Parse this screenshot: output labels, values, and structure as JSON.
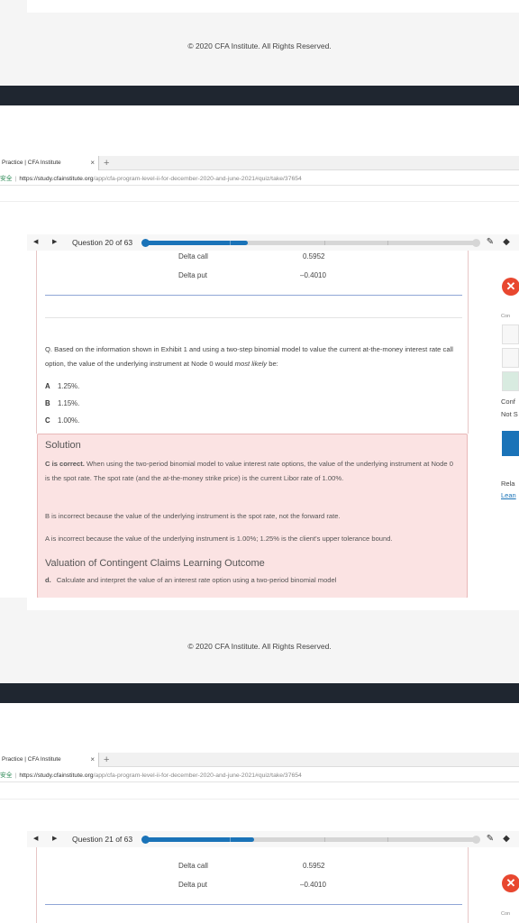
{
  "copyright": "© 2020 CFA Institute. All Rights Reserved.",
  "browser": {
    "tab_title": "Practice | CFA Institute",
    "tab_close": "×",
    "new_tab": "+",
    "secure_label": "安全",
    "url_host": "https://study.cfainstitute.org",
    "url_path": "/app/cfa-program-level-ii-for-december-2020-and-june-2021#quiz/take/37654"
  },
  "quiz1": {
    "question_label": "Question 20 of 63",
    "progress_fraction": 0.31
  },
  "quiz2": {
    "question_label": "Question 21 of 63",
    "progress_fraction": 0.33
  },
  "exhibit": {
    "rows": [
      {
        "label": "Delta call",
        "value": "0.5952"
      },
      {
        "label": "Delta put",
        "value": "–0.4010"
      }
    ]
  },
  "question": {
    "text_before": "Q. Based on the information shown in Exhibit 1 and using a two-step binomial model to value the current at-the-money interest rate call option, the value of the underlying instrument at Node 0 would ",
    "text_emph": "most likely",
    "text_after": " be:",
    "choices": [
      {
        "letter": "A",
        "text": "1.25%."
      },
      {
        "letter": "B",
        "text": "1.15%."
      },
      {
        "letter": "C",
        "text": "1.00%."
      }
    ]
  },
  "solution": {
    "title": "Solution",
    "correct_lead": "C is correct.",
    "correct_text": " When using the two-period binomial model to value interest rate options, the value of the underlying instrument at Node 0 is the spot rate. The spot rate (and the at-the-money strike price) is the current Libor rate of 1.00%.",
    "b_text": "B is incorrect because the value of the underlying instrument is the spot rate, not the forward rate.",
    "a_text": "A is incorrect because the value of the underlying instrument is 1.00%; 1.25% is the client's upper tolerance bound.",
    "lo_title": "Valuation of Contingent Claims Learning Outcome",
    "lo_letter": "d.",
    "lo_text": "Calculate and interpret the value of an interest rate option using a two-period binomial model"
  },
  "side_panel": {
    "con_label": "Con",
    "conf_label": "Conf",
    "not_label": "Not S",
    "rela_label": "Rela",
    "learn_label": "Lean",
    "con2_label": "Con"
  },
  "colors": {
    "accent": "#1a73b8",
    "solution_bg": "#fbe3e3",
    "close_red": "#e8472f"
  }
}
